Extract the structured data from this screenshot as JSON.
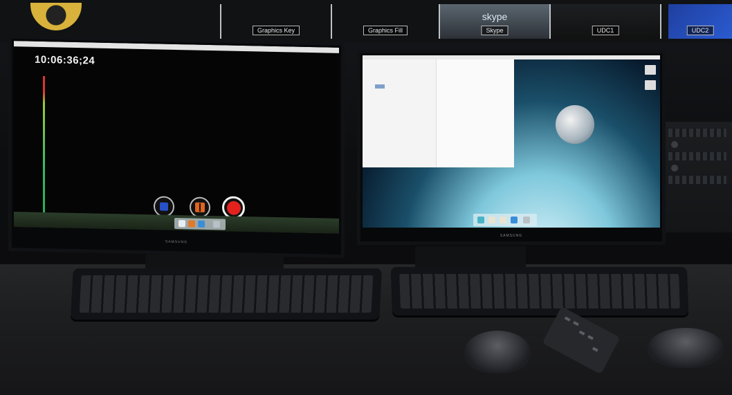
{
  "multiviewer": {
    "tiles": [
      "Graphics Key",
      "Graphics Fill",
      "Skype",
      "UDC1",
      "UDC2"
    ],
    "skype_logo_text": "skype"
  },
  "left_monitor": {
    "timecode": "10:06:36;24",
    "brand": "SAMSUNG"
  },
  "right_monitor": {
    "brand": "SAMSUNG"
  },
  "colors": {
    "record_red": "#e3221e",
    "pause_orange": "#e0651e",
    "stop_blue": "#2850c8"
  }
}
